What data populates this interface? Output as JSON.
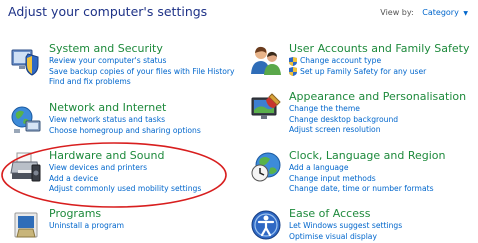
{
  "header": {
    "title": "Adjust your computer's settings",
    "view_by_label": "View by:",
    "view_by_value": "Category"
  },
  "left_column": [
    {
      "title": "System and Security",
      "icon": "shield-computer-icon",
      "links": [
        "Review your computer's status",
        "Save backup copies of your files with File History",
        "Find and fix problems"
      ]
    },
    {
      "title": "Network and Internet",
      "icon": "network-globe-icon",
      "links": [
        "View network status and tasks",
        "Choose homegroup and sharing options"
      ]
    },
    {
      "title": "Hardware and Sound",
      "icon": "printer-speaker-icon",
      "links": [
        "View devices and printers",
        "Add a device",
        "Adjust commonly used mobility settings"
      ]
    },
    {
      "title": "Programs",
      "icon": "programs-box-icon",
      "links": [
        "Uninstall a program"
      ]
    }
  ],
  "right_column": [
    {
      "title": "User Accounts and Family Safety",
      "icon": "users-icon",
      "links": [
        "Change account type",
        "Set up Family Safety for any user"
      ],
      "shield_links": [
        true,
        true
      ]
    },
    {
      "title": "Appearance and Personalisation",
      "icon": "monitor-brush-icon",
      "links": [
        "Change the theme",
        "Change desktop background",
        "Adjust screen resolution"
      ]
    },
    {
      "title": "Clock, Language and Region",
      "icon": "clock-globe-icon",
      "links": [
        "Add a language",
        "Change input methods",
        "Change date, time or number formats"
      ]
    },
    {
      "title": "Ease of Access",
      "icon": "ease-of-access-icon",
      "links": [
        "Let Windows suggest settings",
        "Optimise visual display"
      ]
    }
  ],
  "colors": {
    "header": "#1e3287",
    "category_title": "#1e8a3c",
    "link": "#0066cc",
    "annotation_ellipse": "#d81e1e"
  }
}
